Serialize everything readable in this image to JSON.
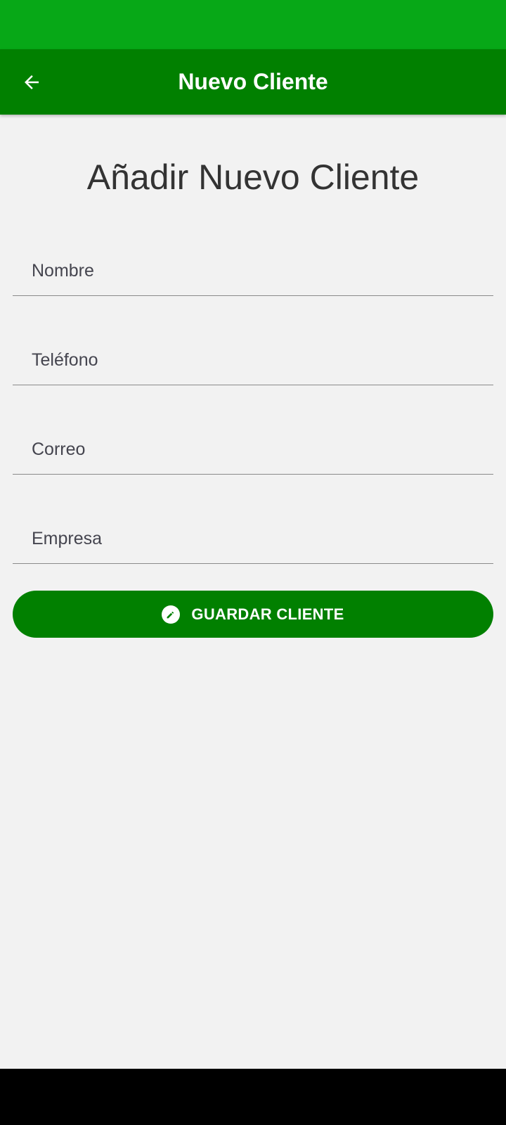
{
  "app_bar": {
    "title": "Nuevo Cliente",
    "back_icon": "arrow-left-icon"
  },
  "form": {
    "heading": "Añadir Nuevo Cliente",
    "fields": [
      {
        "placeholder": "Nombre",
        "value": ""
      },
      {
        "placeholder": "Teléfono",
        "value": ""
      },
      {
        "placeholder": "Correo",
        "value": ""
      },
      {
        "placeholder": "Empresa",
        "value": ""
      }
    ],
    "save_button": {
      "label": "GUARDAR CLIENTE",
      "icon": "pencil-icon"
    }
  },
  "colors": {
    "status_bar": "#07a817",
    "app_bar": "#018000",
    "button": "#018000",
    "background": "#f2f2f2"
  }
}
